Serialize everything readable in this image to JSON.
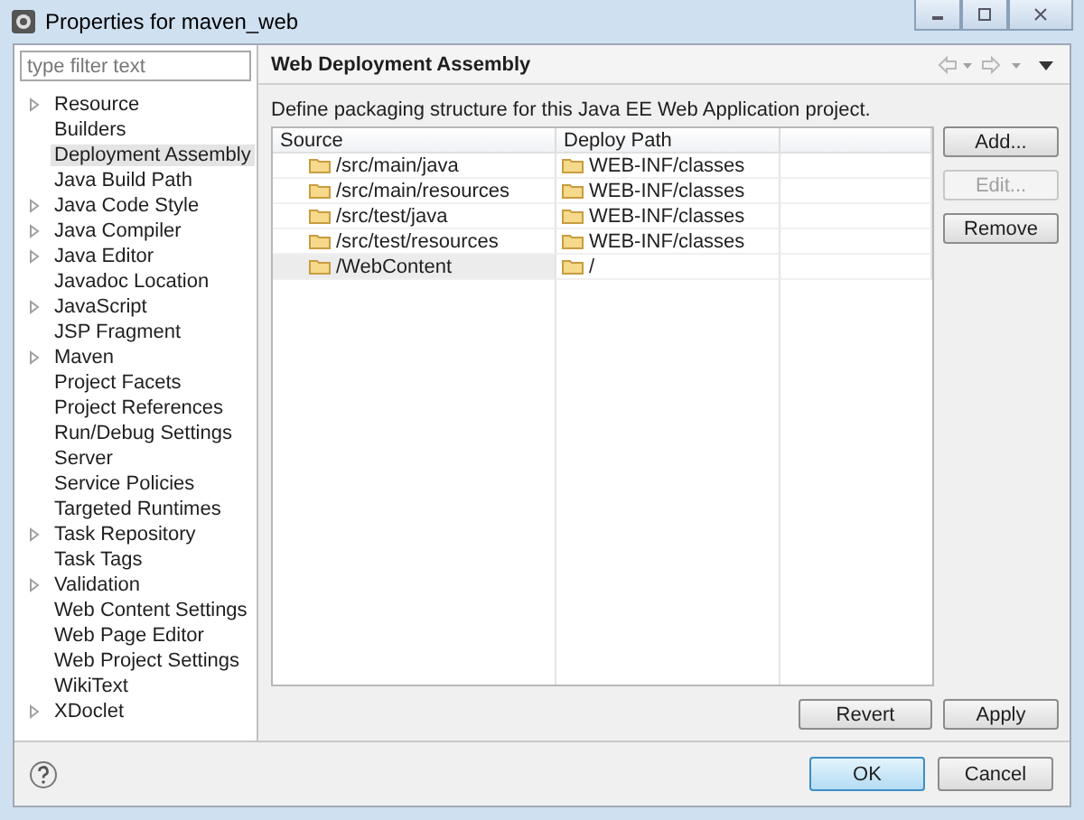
{
  "window": {
    "title": "Properties for maven_web"
  },
  "filter": {
    "placeholder": "type filter text"
  },
  "nav": [
    {
      "label": "Resource",
      "has_children": true,
      "selected": false
    },
    {
      "label": "Builders",
      "has_children": false,
      "selected": false
    },
    {
      "label": "Deployment Assembly",
      "has_children": false,
      "selected": true
    },
    {
      "label": "Java Build Path",
      "has_children": false,
      "selected": false
    },
    {
      "label": "Java Code Style",
      "has_children": true,
      "selected": false
    },
    {
      "label": "Java Compiler",
      "has_children": true,
      "selected": false
    },
    {
      "label": "Java Editor",
      "has_children": true,
      "selected": false
    },
    {
      "label": "Javadoc Location",
      "has_children": false,
      "selected": false
    },
    {
      "label": "JavaScript",
      "has_children": true,
      "selected": false
    },
    {
      "label": "JSP Fragment",
      "has_children": false,
      "selected": false
    },
    {
      "label": "Maven",
      "has_children": true,
      "selected": false
    },
    {
      "label": "Project Facets",
      "has_children": false,
      "selected": false
    },
    {
      "label": "Project References",
      "has_children": false,
      "selected": false
    },
    {
      "label": "Run/Debug Settings",
      "has_children": false,
      "selected": false
    },
    {
      "label": "Server",
      "has_children": false,
      "selected": false
    },
    {
      "label": "Service Policies",
      "has_children": false,
      "selected": false
    },
    {
      "label": "Targeted Runtimes",
      "has_children": false,
      "selected": false
    },
    {
      "label": "Task Repository",
      "has_children": true,
      "selected": false
    },
    {
      "label": "Task Tags",
      "has_children": false,
      "selected": false
    },
    {
      "label": "Validation",
      "has_children": true,
      "selected": false
    },
    {
      "label": "Web Content Settings",
      "has_children": false,
      "selected": false
    },
    {
      "label": "Web Page Editor",
      "has_children": false,
      "selected": false
    },
    {
      "label": "Web Project Settings",
      "has_children": false,
      "selected": false
    },
    {
      "label": "WikiText",
      "has_children": false,
      "selected": false
    },
    {
      "label": "XDoclet",
      "has_children": true,
      "selected": false
    }
  ],
  "page": {
    "title": "Web Deployment Assembly",
    "description": "Define packaging structure for this Java EE Web Application project."
  },
  "table": {
    "columns": [
      "Source",
      "Deploy Path"
    ],
    "rows": [
      {
        "source": "/src/main/java",
        "deploy_path": "WEB-INF/classes",
        "selected": false
      },
      {
        "source": "/src/main/resources",
        "deploy_path": "WEB-INF/classes",
        "selected": false
      },
      {
        "source": "/src/test/java",
        "deploy_path": "WEB-INF/classes",
        "selected": false
      },
      {
        "source": "/src/test/resources",
        "deploy_path": "WEB-INF/classes",
        "selected": false
      },
      {
        "source": "/WebContent",
        "deploy_path": "/",
        "selected": true
      }
    ]
  },
  "side_buttons": [
    {
      "label": "Add...",
      "disabled": false
    },
    {
      "label": "Edit...",
      "disabled": true
    },
    {
      "label": "Remove",
      "disabled": false
    }
  ],
  "page_buttons": [
    {
      "label": "Revert",
      "disabled": false
    },
    {
      "label": "Apply",
      "disabled": false
    }
  ],
  "dialog_buttons": [
    {
      "label": "OK",
      "default": true
    },
    {
      "label": "Cancel",
      "default": false
    }
  ]
}
